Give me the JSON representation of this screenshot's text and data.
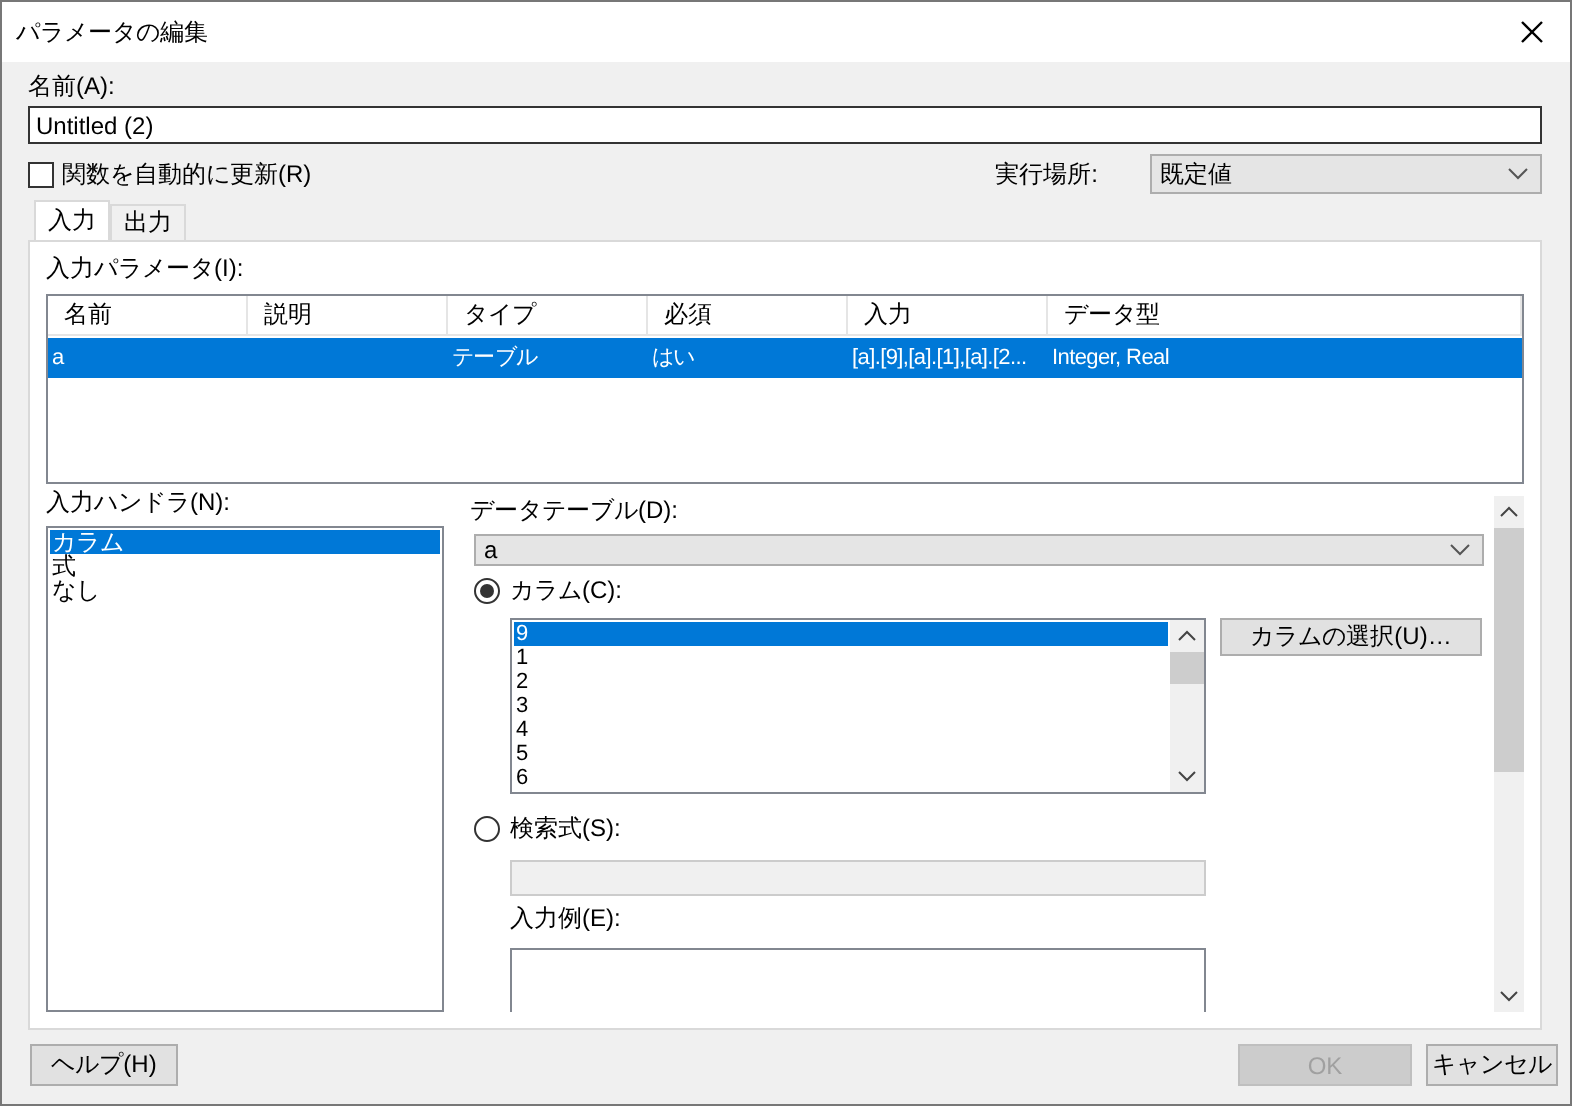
{
  "window": {
    "title": "パラメータの編集"
  },
  "name_field": {
    "label": "名前(A):",
    "value": "Untitled (2)"
  },
  "auto_update": {
    "label": "関数を自動的に更新(R)",
    "checked": false
  },
  "execution_location": {
    "label": "実行場所:",
    "value": "既定値"
  },
  "tabs": [
    {
      "label": "入力",
      "selected": true
    },
    {
      "label": "出力",
      "selected": false
    }
  ],
  "input_parameters": {
    "label": "入力パラメータ(I):",
    "columns": [
      "名前",
      "説明",
      "タイプ",
      "必須",
      "入力",
      "データ型"
    ],
    "rows": [
      {
        "cells": [
          "a",
          null,
          "テーブル",
          "はい",
          "[a].[9],[a].[1],[a].[2...",
          "Integer, Real"
        ],
        "selected": true
      }
    ]
  },
  "input_handlers": {
    "label": "入力ハンドラ(N):",
    "items": [
      {
        "label": "カラム",
        "selected": true
      },
      {
        "label": "式",
        "selected": false
      },
      {
        "label": "なし",
        "selected": false
      }
    ]
  },
  "data_table": {
    "label": "データテーブル(D):",
    "value": "a"
  },
  "column_option": {
    "label": "カラム(C):",
    "selected": true,
    "select_button": "カラムの選択(U)…",
    "items": [
      {
        "label": "9",
        "selected": true
      },
      {
        "label": "1",
        "selected": false
      },
      {
        "label": "2",
        "selected": false
      },
      {
        "label": "3",
        "selected": false
      },
      {
        "label": "4",
        "selected": false
      },
      {
        "label": "5",
        "selected": false
      },
      {
        "label": "6",
        "selected": false
      }
    ]
  },
  "search_option": {
    "label": "検索式(S):",
    "selected": false,
    "field_disabled": true
  },
  "example": {
    "label": "入力例(E):"
  },
  "buttons": [
    {
      "label": "ヘルプ(H)",
      "disabled": false
    },
    {
      "label": "OK",
      "disabled": true
    },
    {
      "label": "キャンセル",
      "disabled": false
    }
  ]
}
